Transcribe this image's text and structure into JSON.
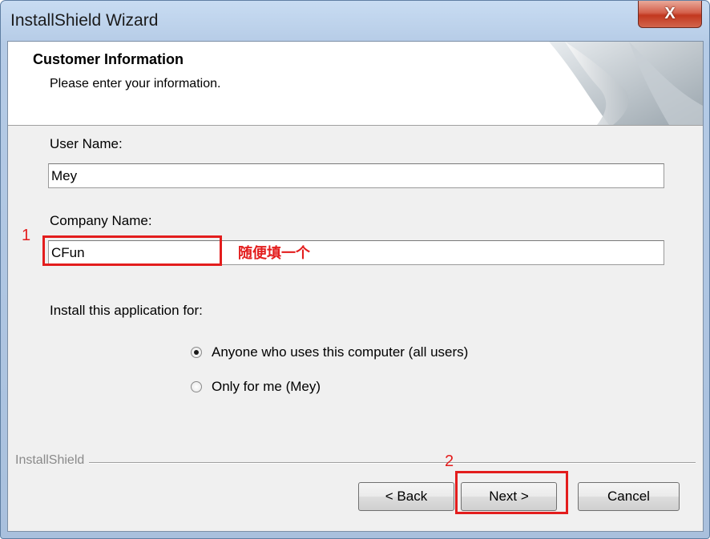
{
  "window": {
    "title": "InstallShield Wizard",
    "close_glyph": "X"
  },
  "header": {
    "title": "Customer Information",
    "subtitle": "Please enter your information."
  },
  "form": {
    "user_name_label": "User Name:",
    "user_name_value": "Mey",
    "company_name_label": "Company Name:",
    "company_name_value": "CFun",
    "install_for_label": "Install this application for:",
    "options": [
      {
        "label": "Anyone who uses this computer (all users)",
        "selected": true
      },
      {
        "label": "Only for me (Mey)",
        "selected": false
      }
    ]
  },
  "footer": {
    "brand": "InstallShield",
    "back_label": "< Back",
    "next_label": "Next >",
    "cancel_label": "Cancel"
  },
  "annotations": {
    "marker_1": "1",
    "marker_2": "2",
    "note": "随便填一个",
    "color": "#e31d1d"
  },
  "icons": {
    "close": "close-icon",
    "radio": "radio-icon",
    "header_art": "page-curl-graphic"
  }
}
